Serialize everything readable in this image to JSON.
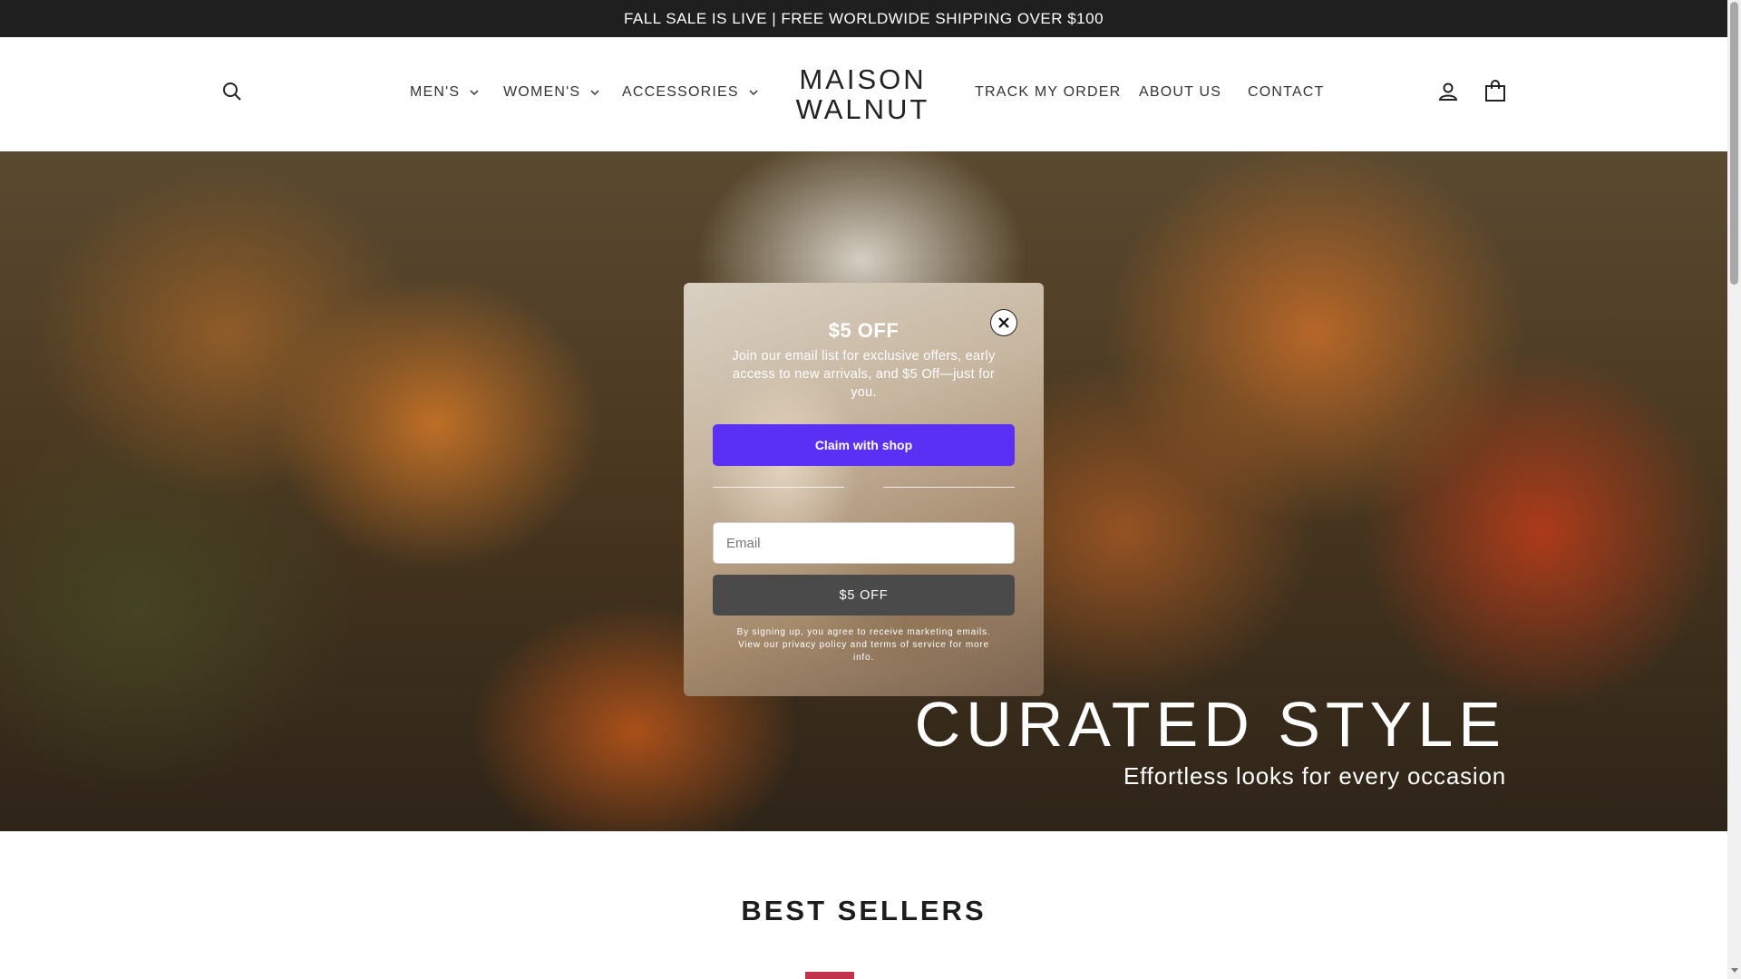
{
  "announcement": {
    "text": "FALL SALE IS LIVE | FREE WORLDWIDE SHIPPING OVER $100"
  },
  "header": {
    "logo_line1": "MAISON",
    "logo_line2": "WALNUT",
    "nav_left": [
      {
        "label": "MEN'S",
        "has_dropdown": true
      },
      {
        "label": "WOMEN'S",
        "has_dropdown": true
      },
      {
        "label": "ACCESSORIES",
        "has_dropdown": true
      }
    ],
    "nav_right": [
      {
        "label": "TRACK MY ORDER"
      },
      {
        "label": "ABOUT US"
      },
      {
        "label": "CONTACT"
      }
    ],
    "icons": [
      "search-icon",
      "account-icon",
      "bag-icon"
    ]
  },
  "hero": {
    "title": "CURATED STYLE",
    "subtitle": "Effortless looks for every occasion"
  },
  "popup": {
    "title": "$5 OFF",
    "description": "Join our email list for exclusive offers, early access to new arrivals, and $5 Off—just for you.",
    "shop_button_prefix": "Claim with",
    "shop_button_brand": "shop",
    "email_placeholder": "Email",
    "submit_label": "$5 OFF",
    "legal": "By signing up, you agree to receive marketing emails. View our privacy policy and terms of service for more info.",
    "colors": {
      "shop_button": "#5a31f4",
      "submit_button": "#4a4a4a"
    }
  },
  "section": {
    "title": "BEST SELLERS"
  },
  "colors": {
    "announcement_bg": "#1f1f1f",
    "badge": "#c0334a"
  }
}
